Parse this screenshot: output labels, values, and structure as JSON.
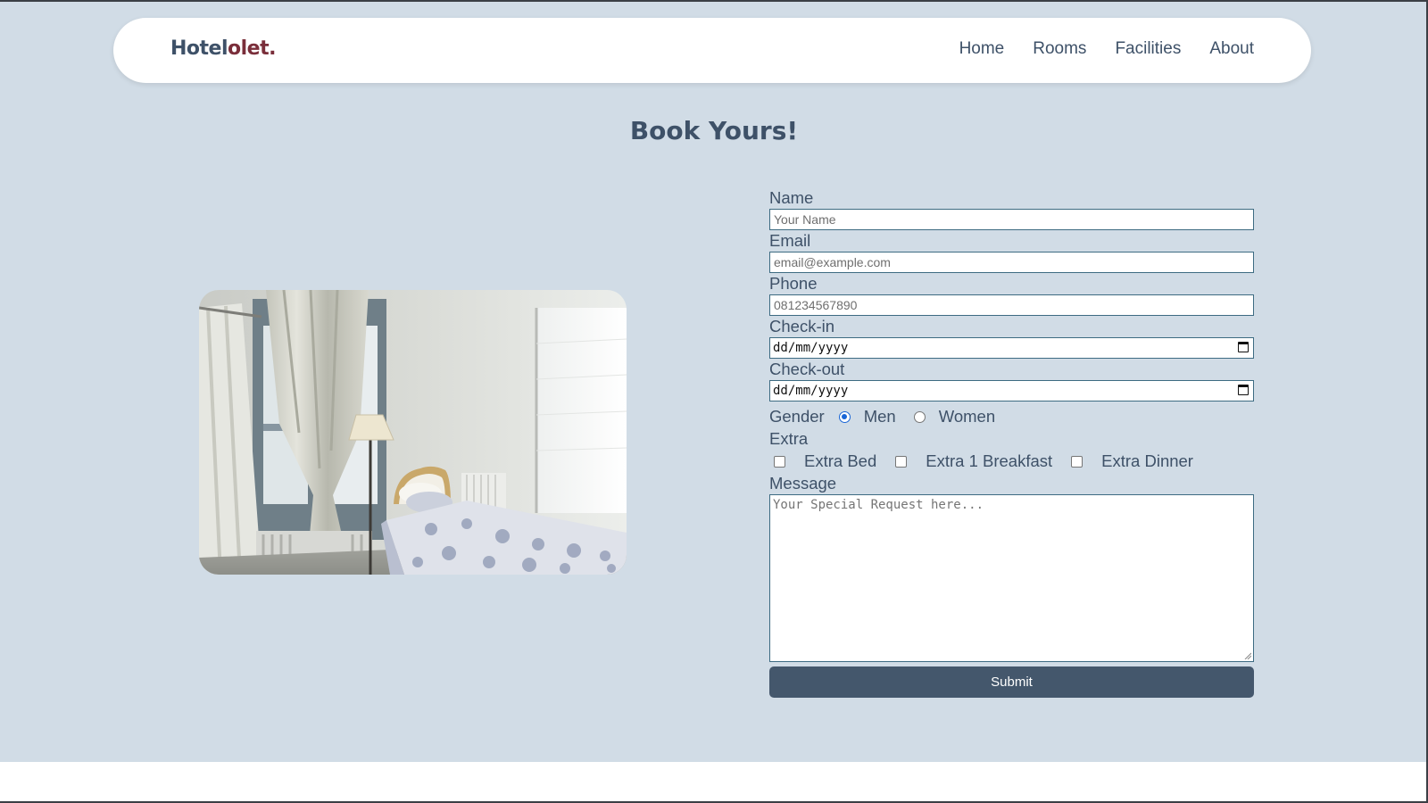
{
  "brand": {
    "part1": "Hotel",
    "part2": "olet."
  },
  "nav": {
    "items": [
      {
        "label": "Home"
      },
      {
        "label": "Rooms"
      },
      {
        "label": "Facilities"
      },
      {
        "label": "About"
      }
    ]
  },
  "page_title": "Book Yours!",
  "form": {
    "name": {
      "label": "Name",
      "placeholder": "Your Name"
    },
    "email": {
      "label": "Email",
      "placeholder": "email@example.com"
    },
    "phone": {
      "label": "Phone",
      "placeholder": "081234567890"
    },
    "checkin": {
      "label": "Check-in",
      "value": "dd/mm/yyyy"
    },
    "checkout": {
      "label": "Check-out",
      "value": "dd/mm/yyyy"
    },
    "gender": {
      "label": "Gender",
      "options": [
        {
          "label": "Men",
          "checked": true
        },
        {
          "label": "Women",
          "checked": false
        }
      ]
    },
    "extra": {
      "label": "Extra",
      "options": [
        {
          "label": "Extra Bed",
          "checked": false
        },
        {
          "label": "Extra 1 Breakfast",
          "checked": false
        },
        {
          "label": "Extra Dinner",
          "checked": false
        }
      ]
    },
    "message": {
      "label": "Message",
      "placeholder": "Your Special Request here..."
    },
    "submit_label": "Submit"
  },
  "colors": {
    "page_bg": "#d1dce6",
    "brand_dark": "#3e5168",
    "brand_accent": "#7a2e3a",
    "button_bg": "#44576c",
    "radio_checked": "#1a66d6"
  }
}
